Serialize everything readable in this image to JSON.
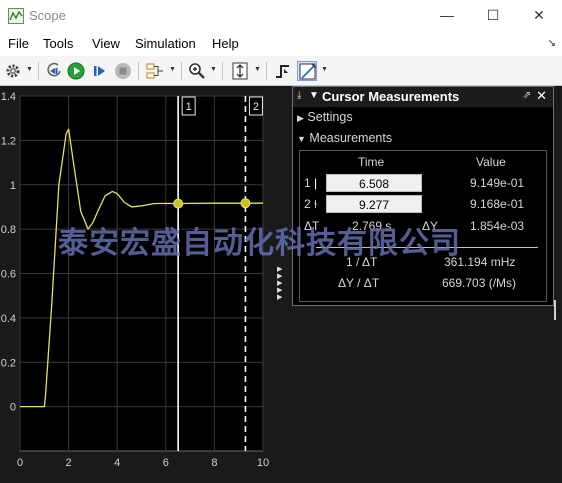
{
  "window": {
    "title": "Scope"
  },
  "menu": [
    "File",
    "Tools",
    "View",
    "Simulation",
    "Help"
  ],
  "toolbar": {
    "icons": [
      "gear-icon",
      "step-back-icon",
      "run-icon",
      "step-forward-icon",
      "stop-icon",
      "signal-selector-icon",
      "zoom-icon",
      "autoscale-icon",
      "trigger-icon",
      "cursor-measurements-icon"
    ]
  },
  "plot": {
    "cursor_labels": [
      "1",
      "2"
    ]
  },
  "chart_data": {
    "type": "line",
    "title": "",
    "xlabel": "",
    "ylabel": "",
    "xlim": [
      0,
      10
    ],
    "ylim": [
      -0.2,
      1.4
    ],
    "x_ticks": [
      "0",
      "2",
      "4",
      "6",
      "8",
      "10"
    ],
    "y_ticks": [
      "0",
      "0.2",
      "0.4",
      "0.6",
      "0.8",
      "1",
      "1.2",
      "1.4"
    ],
    "grid": true,
    "line_color": "#e6e25a",
    "background": "#000000",
    "series": [
      {
        "x": [
          0,
          1,
          1.05,
          1.3,
          1.6,
          1.9,
          2.0,
          2.2,
          2.5,
          2.8,
          3.0,
          3.2,
          3.5,
          3.8,
          4.0,
          4.3,
          4.6,
          5.0,
          5.5,
          6.0,
          6.508,
          7.0,
          8.0,
          9.277,
          10
        ],
        "y": [
          0,
          0,
          0.05,
          0.45,
          1.0,
          1.23,
          1.25,
          1.1,
          0.88,
          0.8,
          0.83,
          0.88,
          0.95,
          0.97,
          0.96,
          0.92,
          0.9,
          0.905,
          0.915,
          0.916,
          0.915,
          0.916,
          0.917,
          0.917,
          0.917
        ]
      }
    ],
    "cursors": [
      {
        "label": "1",
        "x": 6.508,
        "y": 0.9149,
        "style": "solid"
      },
      {
        "label": "2",
        "x": 9.277,
        "y": 0.9168,
        "style": "dashed"
      }
    ]
  },
  "cursor_panel": {
    "title": "Cursor Measurements",
    "settings_label": "Settings",
    "measurements_label": "Measurements",
    "col_time": "Time",
    "col_value": "Value",
    "row1": {
      "label": "1",
      "time": "6.508",
      "value": "9.149e-01"
    },
    "row2": {
      "label": "2",
      "time": "9.277",
      "value": "9.168e-01"
    },
    "delta_t_label": "ΔT",
    "delta_t": "2.769 s",
    "delta_y_label": "ΔY",
    "delta_y": "1.854e-03",
    "inv_dt_label": "1 / ΔT",
    "inv_dt": "361.194 mHz",
    "dy_dt_label": "ΔY / ΔT",
    "dy_dt": "669.703 (/Ms)"
  },
  "watermark": {
    "text": "泰安宏盛自动化科技有限公司"
  }
}
